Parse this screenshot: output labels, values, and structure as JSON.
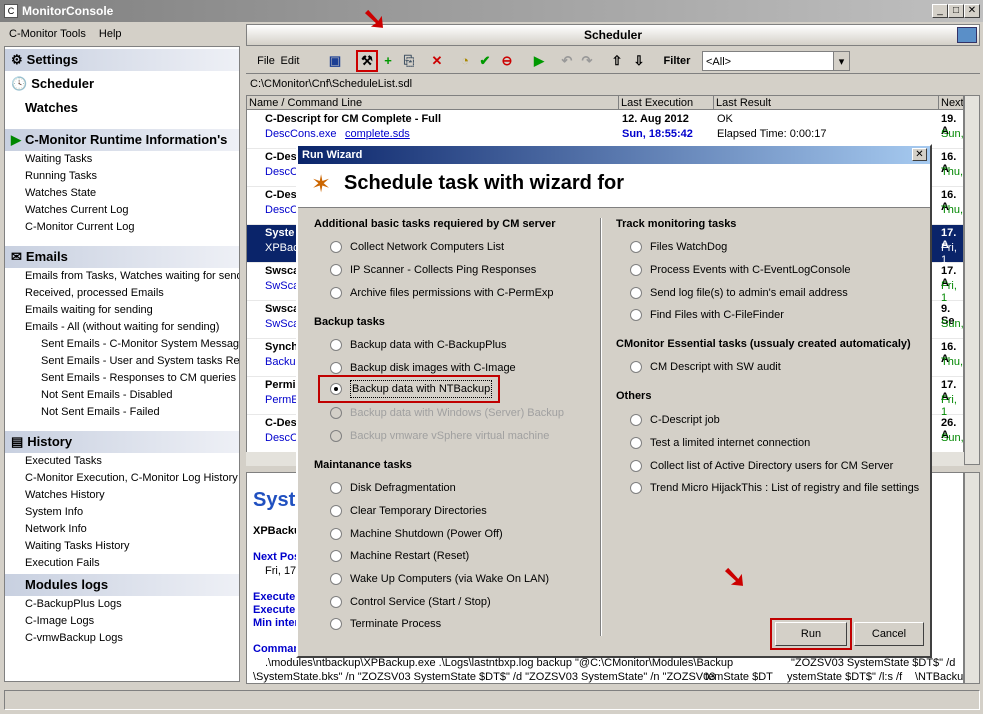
{
  "window": {
    "title": "MonitorConsole",
    "app_icon": "C",
    "min": "_",
    "max": "□",
    "close": "✕"
  },
  "menu": {
    "items": [
      "C-Monitor Tools",
      "Help"
    ]
  },
  "sidebar": {
    "settings": "Settings",
    "scheduler": "Scheduler",
    "watches": "Watches",
    "runtime": "C-Monitor Runtime Information's",
    "runtime_items": [
      "Waiting Tasks",
      "Running Tasks",
      "Watches State",
      "Watches Current Log",
      "C-Monitor Current Log"
    ],
    "emails": "Emails",
    "email_items": [
      "Emails from Tasks, Watches waiting for sending",
      "Received, processed Emails",
      "Emails waiting for sending",
      "Emails - All (without waiting for sending)"
    ],
    "email_sub": [
      "Sent Emails - C-Monitor System Messages",
      "Sent Emails - User and System tasks Results",
      "Sent Emails - Responses to CM queries",
      "Not Sent Emails - Disabled",
      "Not Sent Emails - Failed"
    ],
    "history": "History",
    "history_items": [
      "Executed Tasks",
      "C-Monitor Execution, C-Monitor Log History",
      "Watches History",
      "System Info",
      "Network Info",
      "Waiting Tasks History",
      "Execution Fails"
    ],
    "modules": "Modules logs",
    "module_items": [
      "C-BackupPlus Logs",
      "C-Image Logs",
      "C-vmwBackup Logs"
    ]
  },
  "scheduler": {
    "title": "Scheduler",
    "file": "File",
    "edit": "Edit",
    "filter_label": "Filter",
    "filter_value": "<All>",
    "path": "C:\\CMonitor\\Cnf\\ScheduleList.sdl"
  },
  "grid": {
    "columns": [
      "Name / Command Line",
      "Last Execution",
      "Last Result",
      "Next"
    ],
    "rows": [
      {
        "name": "C-Descript for CM Complete - Full",
        "cmd": "DescCons.exe",
        "arg": "complete.sds",
        "date": "12. Aug 2012",
        "time": "Sun, 18:55:42",
        "result": "OK",
        "result2": "Elapsed Time: 0:00:17",
        "next": "19. A",
        "next2": "Sun,"
      },
      {
        "name": "C-Des",
        "cmd": "DescC",
        "arg": "",
        "date": "",
        "time": "",
        "result": "",
        "result2": "",
        "next": "16. A",
        "next2": "Thu,"
      },
      {
        "name": "C-Des",
        "cmd": "DescC",
        "arg": "",
        "date": "",
        "time": "",
        "result": "",
        "result2": "",
        "next": "16. A",
        "next2": "Thu,"
      },
      {
        "name": "Syste",
        "cmd": "XPBack",
        "arg": "",
        "date": "",
        "time": "",
        "result": "",
        "result2": "",
        "next": "17. A",
        "next2": "Fri, 1"
      },
      {
        "name": "Swsca",
        "cmd": "SwSca",
        "arg": "",
        "date": "",
        "time": "",
        "result": "",
        "result2": "",
        "next": "17. A",
        "next2": "Fri, 1"
      },
      {
        "name": "Swsca",
        "cmd": "SwSca",
        "arg": "",
        "date": "",
        "time": "",
        "result": "",
        "result2": "",
        "next": "9. Se",
        "next2": "Sun,"
      },
      {
        "name": "Synch",
        "cmd": "Backup",
        "arg": "",
        "date": "",
        "time": "",
        "result": "",
        "result2": "",
        "next": "16. A",
        "next2": "Thu,"
      },
      {
        "name": "Permi",
        "cmd": "PermEx",
        "arg": "",
        "date": "",
        "time": "",
        "result": "",
        "result2": "",
        "next": "17. A",
        "next2": "Fri, 1"
      },
      {
        "name": "C-Des",
        "cmd": "DescC",
        "arg": "",
        "date": "",
        "time": "",
        "result": "",
        "result2": "",
        "next": "26. A",
        "next2": "Sun,"
      }
    ]
  },
  "detail": {
    "title": "Syste",
    "sub": "XPBackup",
    "next_pos": "Next Pos",
    "next_date": "Fri, 17.",
    "exec1": "Execute",
    "exec2": "Execute",
    "min": "Min inter",
    "command": "Comman",
    "cmd1": ".\\modules\\ntbackup\\XPBackup.exe .\\Logs\\lastntbxp.log backup \"@C:\\CMonitor\\Modules\\Backup",
    "cmd1b": "\"ZOZSV03 SystemState   $DT$\" /d",
    "cmd2": "\\SystemState.bks\" /n \"ZOZSV03 SystemState $DT$\" /d \"ZOZSV03 SystemState\" /n \"ZOZSV03",
    "cmd2b": "temState $DT",
    "cmd2c": "ystemState $DT$\" /l:s /f",
    "cmd2d": "\\NTBackup"
  },
  "dialog": {
    "title": "Run Wizard",
    "close": "✕",
    "heading": "Schedule task with wizard for",
    "groups": {
      "additional": "Additional basic tasks requiered by CM server",
      "backup": "Backup tasks",
      "maintenance": "Maintanance tasks",
      "track": "Track monitoring tasks",
      "essential": "CMonitor Essential tasks (ussualy created automaticaly)",
      "others": "Others"
    },
    "additional": [
      "Collect Network Computers List",
      "IP Scanner - Collects Ping Responses",
      "Archive files permissions with C-PermExp"
    ],
    "backup": [
      "Backup data with C-BackupPlus",
      "Backup disk images with C-Image",
      "Backup data with NTBackup",
      "Backup data with Windows (Server) Backup",
      "Backup vmware vSphere virtual machine"
    ],
    "maintenance": [
      "Disk Defragmentation",
      "Clear Temporary Directories",
      "Machine Shutdown (Power Off)",
      "Machine Restart (Reset)",
      "Wake Up Computers (via Wake On LAN)",
      "Control Service (Start / Stop)",
      "Terminate Process"
    ],
    "track": [
      "Files WatchDog",
      "Process Events with C-EventLogConsole",
      "Send log file(s) to admin's email address",
      "Find Files with C-FileFinder"
    ],
    "essential": [
      "CM Descript with SW audit"
    ],
    "others": [
      "C-Descript job",
      "Test a limited internet connection",
      "Collect list of Active Directory users for CM Server",
      "Trend Micro HijackThis : List of registry and file settings"
    ],
    "run": "Run",
    "cancel": "Cancel"
  }
}
